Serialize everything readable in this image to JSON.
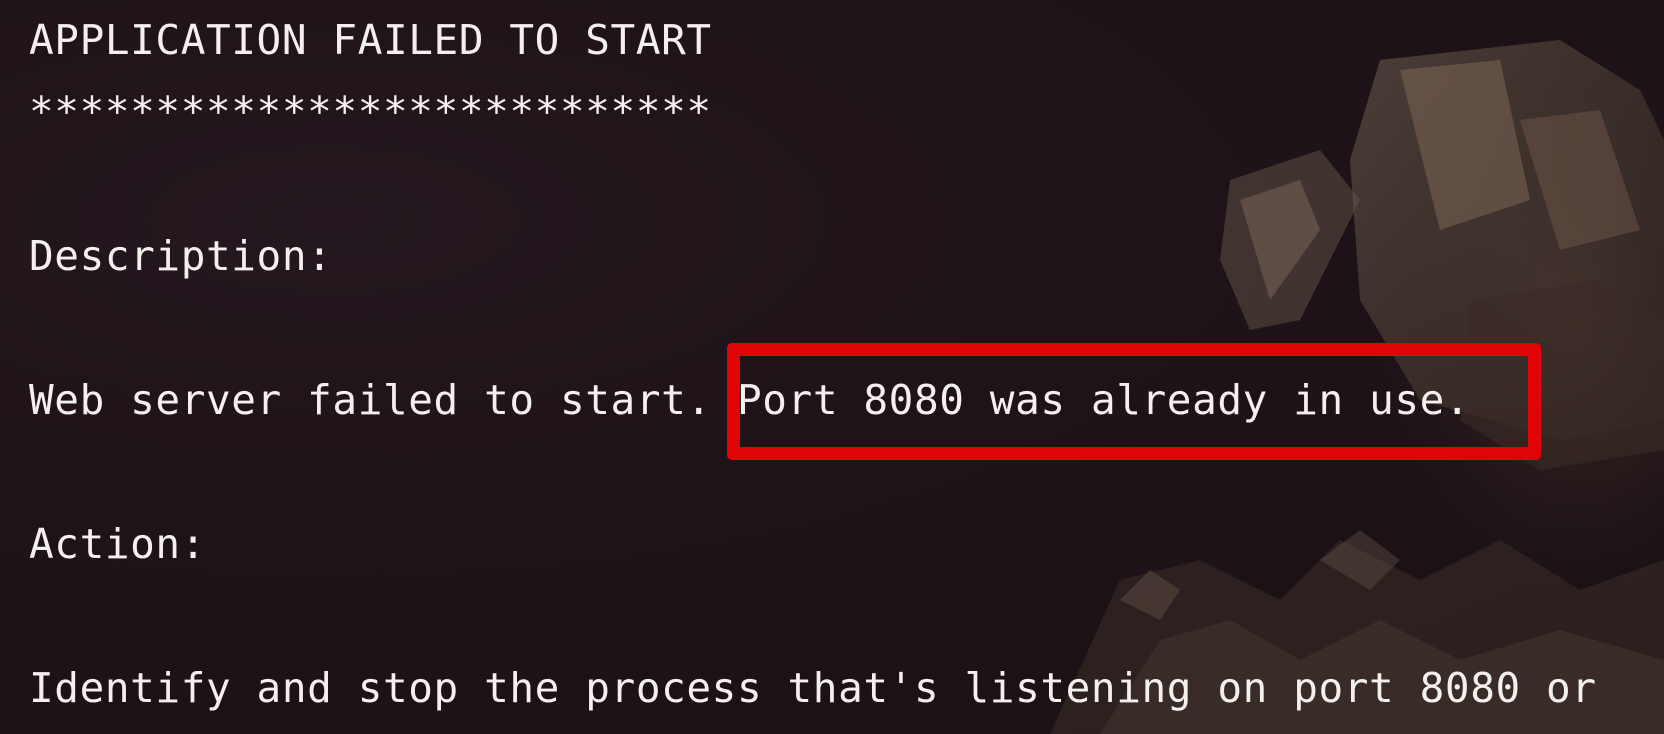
{
  "terminal": {
    "title_line": "APPLICATION FAILED TO START",
    "separator": "***************************",
    "description_label": "Description:",
    "error_part1": "Web server failed to start. ",
    "error_part2": "Port 8080 was already in use.",
    "action_label": "Action:",
    "action_text": "Identify and stop the process that's listening on port 8080 or"
  },
  "colors": {
    "background": "#1e1318",
    "text": "#f4f0ee",
    "highlight_border": "#e00408"
  }
}
